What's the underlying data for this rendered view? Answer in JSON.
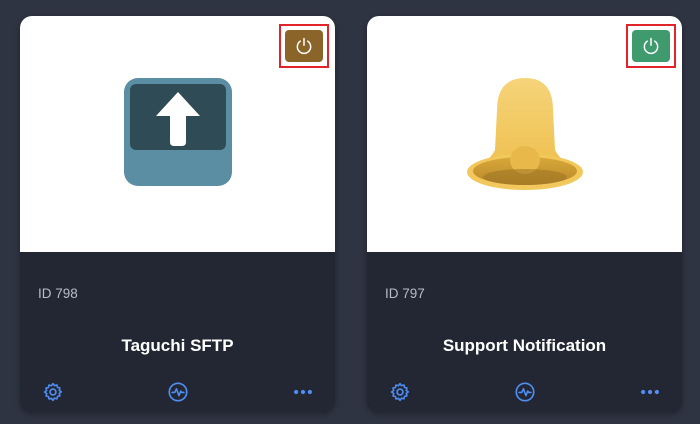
{
  "cards": [
    {
      "id_label": "ID 798",
      "title": "Taguchi SFTP",
      "illustration": "upload-tray-icon",
      "power_color": "#8a6428",
      "power_icon": "power-icon",
      "actions": [
        "gear-icon",
        "activity-pulse-icon",
        "more-dots-icon"
      ]
    },
    {
      "id_label": "ID 797",
      "title": "Support Notification",
      "illustration": "bell-icon",
      "power_color": "#3f9a6e",
      "power_icon": "power-icon",
      "actions": [
        "gear-icon",
        "activity-pulse-icon",
        "more-dots-icon"
      ]
    }
  ],
  "colors": {
    "background": "#2f3443",
    "card_footer": "#232733",
    "accent_blue": "#4f8ef5",
    "highlight_red": "#e0242a"
  }
}
